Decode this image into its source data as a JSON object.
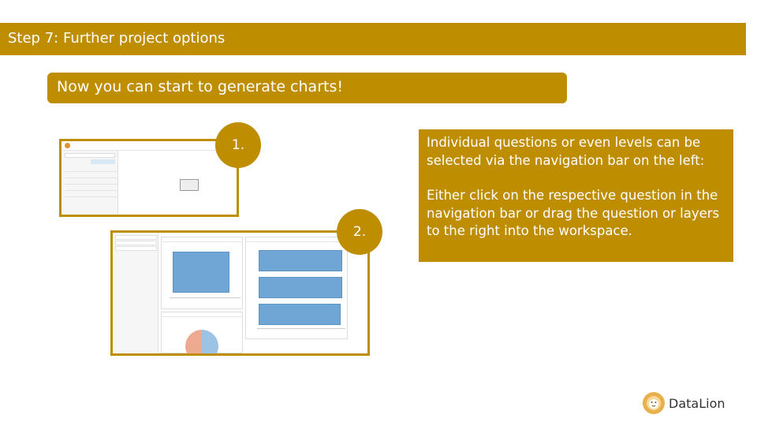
{
  "slide": {
    "title": "Step 7: Further project options",
    "headline": "Now you can start to generate charts!",
    "info_paragraph_1": "Individual questions or even levels can be selected via the navigation bar on the left:",
    "info_paragraph_2": "Either click on the respective question in the navigation bar or drag the question or layers to the right into the workspace.",
    "step_1_label": "1.",
    "step_2_label": "2."
  },
  "brand": {
    "name": "DataLion",
    "icon": "lion-logo-icon"
  },
  "colors": {
    "accent": "#bf8d00",
    "bar": "#6fa6d6",
    "pie_left": "#eeaa90",
    "pie_right": "#9cc3e4"
  }
}
